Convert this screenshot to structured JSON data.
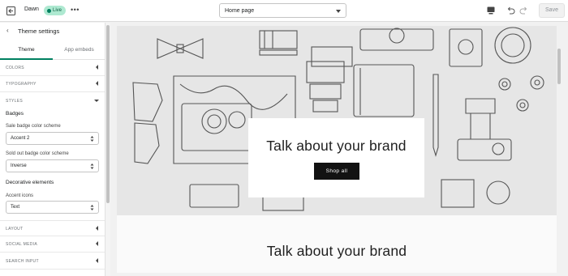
{
  "topbar": {
    "theme_name": "Dawn",
    "live_label": "Live",
    "more_label": "•••",
    "page_select": "Home page",
    "save_label": "Save"
  },
  "sidebar": {
    "back_icon": "‹",
    "title": "Theme settings",
    "tabs": [
      {
        "label": "Theme",
        "active": true
      },
      {
        "label": "App embeds",
        "active": false
      }
    ],
    "sections": {
      "colors": "COLORS",
      "typography": "TYPOGRAPHY",
      "styles": "STYLES",
      "layout": "LAYOUT",
      "social_media": "SOCIAL MEDIA",
      "search_input": "SEARCH INPUT"
    },
    "styles": {
      "badges_heading": "Badges",
      "sale_label": "Sale badge color scheme",
      "sale_value": "Accent 2",
      "sold_out_label": "Sold out badge color scheme",
      "sold_out_value": "Inverse",
      "decorative_heading": "Decorative elements",
      "accent_label": "Accent icons",
      "accent_value": "Text"
    }
  },
  "preview": {
    "hero_title": "Talk about your brand",
    "hero_button": "Shop all",
    "lower_title": "Talk about your brand"
  },
  "colors": {
    "accent_green": "#008060",
    "live_badge": "#aee9d1",
    "button_dark": "#121212"
  },
  "icons": {
    "exit": "exit-icon",
    "more": "more-icon",
    "device": "device-icon",
    "undo": "undo-icon",
    "redo": "redo-icon",
    "back": "chevron-left-icon"
  }
}
